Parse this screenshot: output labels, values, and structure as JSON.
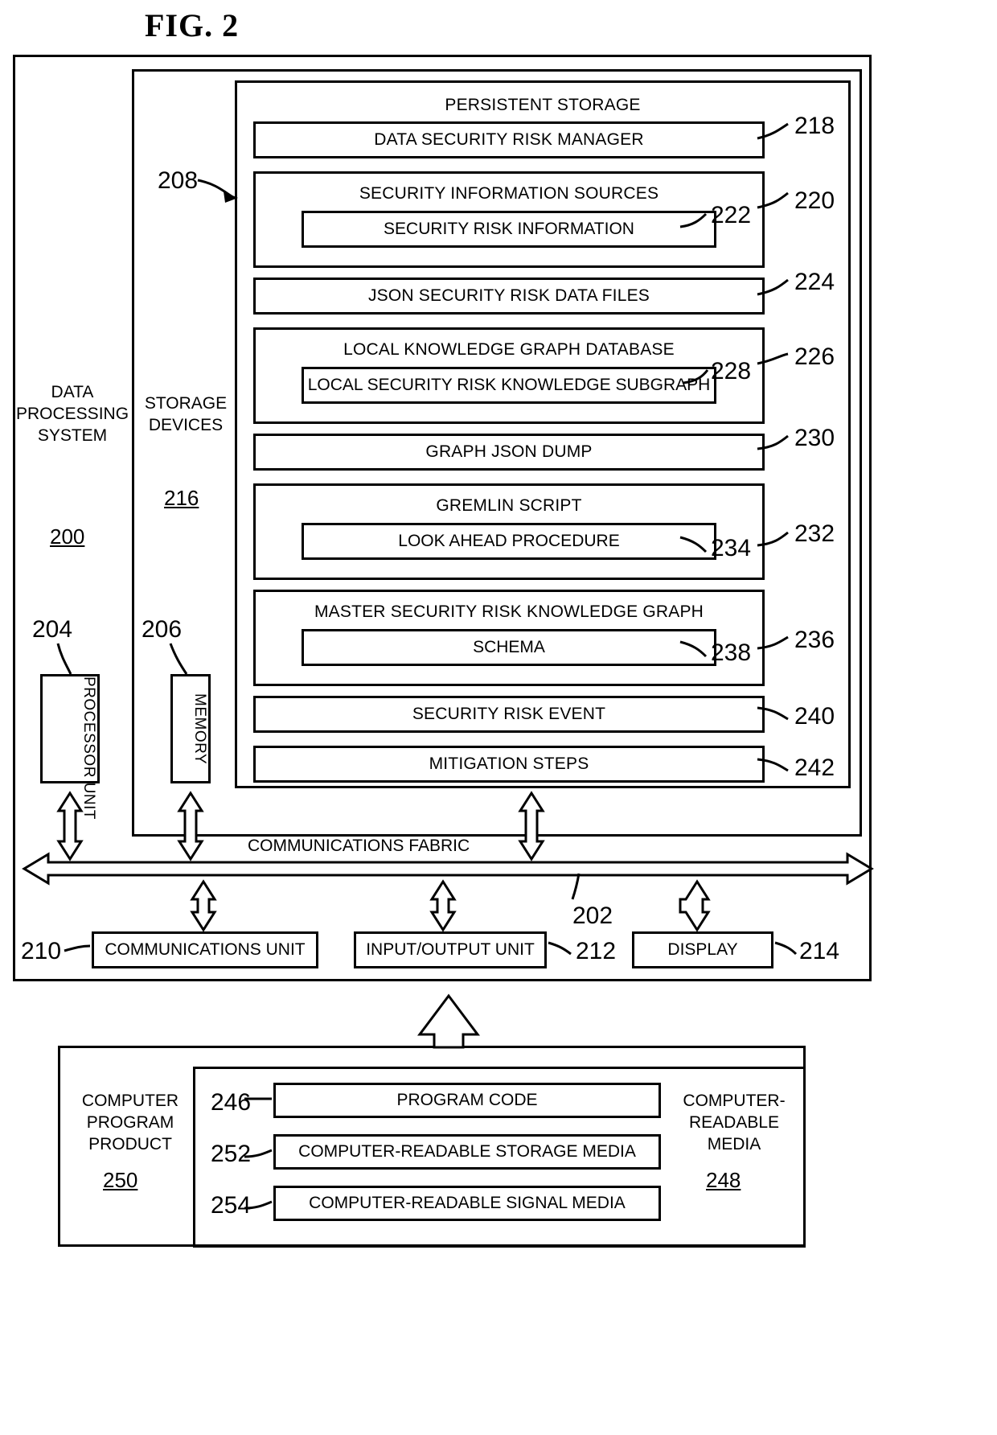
{
  "figure": {
    "title": "FIG. 2"
  },
  "system": {
    "label_line1": "DATA",
    "label_line2": "PROCESSING",
    "label_line3": "SYSTEM",
    "ref": "200"
  },
  "storage_devices": {
    "label_line1": "STORAGE",
    "label_line2": "DEVICES",
    "ref": "216"
  },
  "persistent_storage": {
    "title": "PERSISTENT STORAGE",
    "ref": "208",
    "modules": [
      {
        "label": "DATA SECURITY RISK MANAGER",
        "ref": "218",
        "child": null,
        "child_ref": null
      },
      {
        "label": "SECURITY INFORMATION SOURCES",
        "ref": "220",
        "child": "SECURITY RISK INFORMATION",
        "child_ref": "222"
      },
      {
        "label": "JSON SECURITY RISK DATA FILES",
        "ref": "224",
        "child": null,
        "child_ref": null
      },
      {
        "label": "LOCAL KNOWLEDGE GRAPH DATABASE",
        "ref": "226",
        "child": "LOCAL SECURITY RISK KNOWLEDGE SUBGRAPH",
        "child_ref": "228"
      },
      {
        "label": "GRAPH JSON DUMP",
        "ref": "230",
        "child": null,
        "child_ref": null
      },
      {
        "label": "GREMLIN SCRIPT",
        "ref": "232",
        "child": "LOOK AHEAD PROCEDURE",
        "child_ref": "234"
      },
      {
        "label": "MASTER SECURITY RISK KNOWLEDGE GRAPH",
        "ref": "236",
        "child": "SCHEMA",
        "child_ref": "238"
      },
      {
        "label": "SECURITY RISK EVENT",
        "ref": "240",
        "child": null,
        "child_ref": null
      },
      {
        "label": "MITIGATION STEPS",
        "ref": "242",
        "child": null,
        "child_ref": null
      }
    ]
  },
  "processor_unit": {
    "label": "PROCESSOR UNIT",
    "ref": "204"
  },
  "memory": {
    "label": "MEMORY",
    "ref": "206"
  },
  "communications_fabric": {
    "label": "COMMUNICATIONS FABRIC",
    "ref": "202"
  },
  "io_units": [
    {
      "label": "COMMUNICATIONS UNIT",
      "ref": "210"
    },
    {
      "label": "INPUT/OUTPUT UNIT",
      "ref": "212"
    },
    {
      "label": "DISPLAY",
      "ref": "214"
    }
  ],
  "computer_program_product": {
    "label_line1": "COMPUTER",
    "label_line2": "PROGRAM",
    "label_line3": "PRODUCT",
    "ref": "250"
  },
  "computer_readable_media": {
    "label_line1": "COMPUTER-",
    "label_line2": "READABLE",
    "label_line3": "MEDIA",
    "ref": "248",
    "items": [
      {
        "label": "PROGRAM CODE",
        "ref": "246"
      },
      {
        "label": "COMPUTER-READABLE STORAGE MEDIA",
        "ref": "252"
      },
      {
        "label": "COMPUTER-READABLE SIGNAL MEDIA",
        "ref": "254"
      }
    ]
  }
}
